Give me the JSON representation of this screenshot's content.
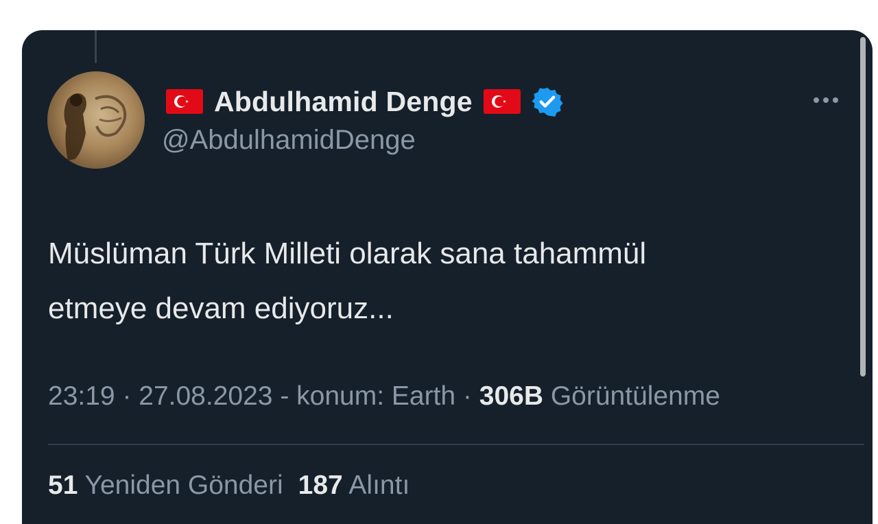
{
  "colors": {
    "background": "#15202b",
    "text": "#e7e9ea",
    "secondary_text": "#8b98a5",
    "verified_blue": "#1d9bf0",
    "flag_red": "#e30a17"
  },
  "tweet": {
    "author": {
      "display_name": "Abdulhamid Denge",
      "handle": "@AbdulhamidDenge",
      "name_flag": "turkey-flag",
      "verified": true
    },
    "text_lines": [
      "Müslüman Türk Milleti olarak sana tahammül",
      "etmeye devam ediyoruz..."
    ],
    "meta": {
      "time": "23:19",
      "separator1": " · ",
      "date": "27.08.2023",
      "location": " - konum: Earth",
      "separator2": " · ",
      "views_count": "306B",
      "views_label": " Görüntülenme"
    },
    "stats": {
      "reposts_count": "51",
      "reposts_label": " Yeniden Gönderi",
      "quotes_count": "187",
      "quotes_label": " Alıntı"
    }
  },
  "icons": {
    "more": "more-horizontal-icon",
    "verified": "verified-badge-icon",
    "flag": "turkey-flag-icon"
  }
}
